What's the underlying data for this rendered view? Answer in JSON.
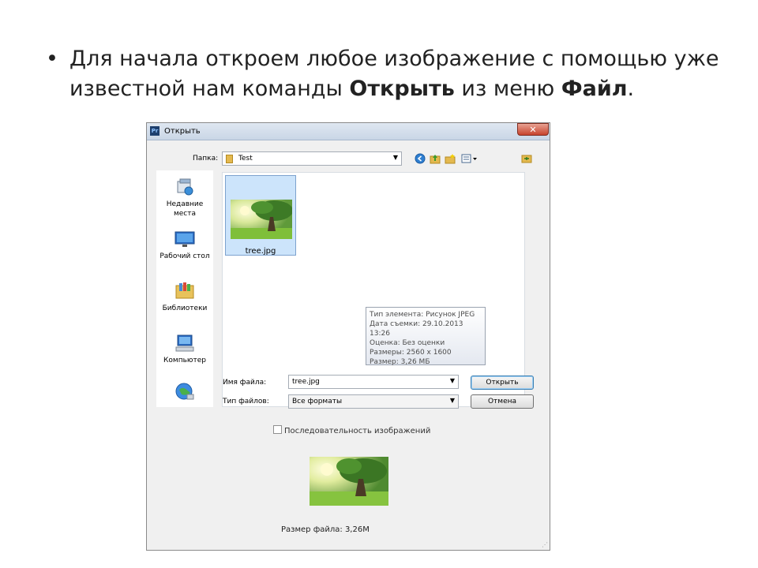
{
  "slide": {
    "bullet": "•",
    "text_part1": "Для начала откроем любое изображение с помощью уже известной нам команды ",
    "bold1": "Открыть",
    "text_part2": " из меню ",
    "bold2": "Файл",
    "text_part3": "."
  },
  "dialog": {
    "app_icon": "Pr",
    "title": "Открыть",
    "close": "✕",
    "look_in_label": "Папка:",
    "look_in_value": "Test",
    "places": [
      {
        "label": "Недавние места",
        "icon": "recent-places-icon"
      },
      {
        "label": "Рабочий стол",
        "icon": "desktop-icon"
      },
      {
        "label": "Библиотеки",
        "icon": "libraries-icon"
      },
      {
        "label": "Компьютер",
        "icon": "computer-icon"
      },
      {
        "label": "",
        "icon": "network-icon"
      }
    ],
    "file": {
      "name": "tree.jpg"
    },
    "tooltip": {
      "type": "Тип элемента: Рисунок JPEG",
      "date": "Дата съемки: 29.10.2013 13:26",
      "rating": "Оценка: Без оценки",
      "dimensions": "Размеры: 2560 x 1600",
      "size": "Размер: 3,26 МБ"
    },
    "filename_label": "Имя файла:",
    "filename_value": "tree.jpg",
    "filetype_label": "Тип файлов:",
    "filetype_value": "Все форматы",
    "open_button": "Открыть",
    "cancel_button": "Отмена",
    "sequence_label": "Последовательность изображений",
    "file_size_text": "Размер файла: 3,26M"
  },
  "colors": {
    "selection": "#cce4fb",
    "close_button": "#c7432d"
  }
}
